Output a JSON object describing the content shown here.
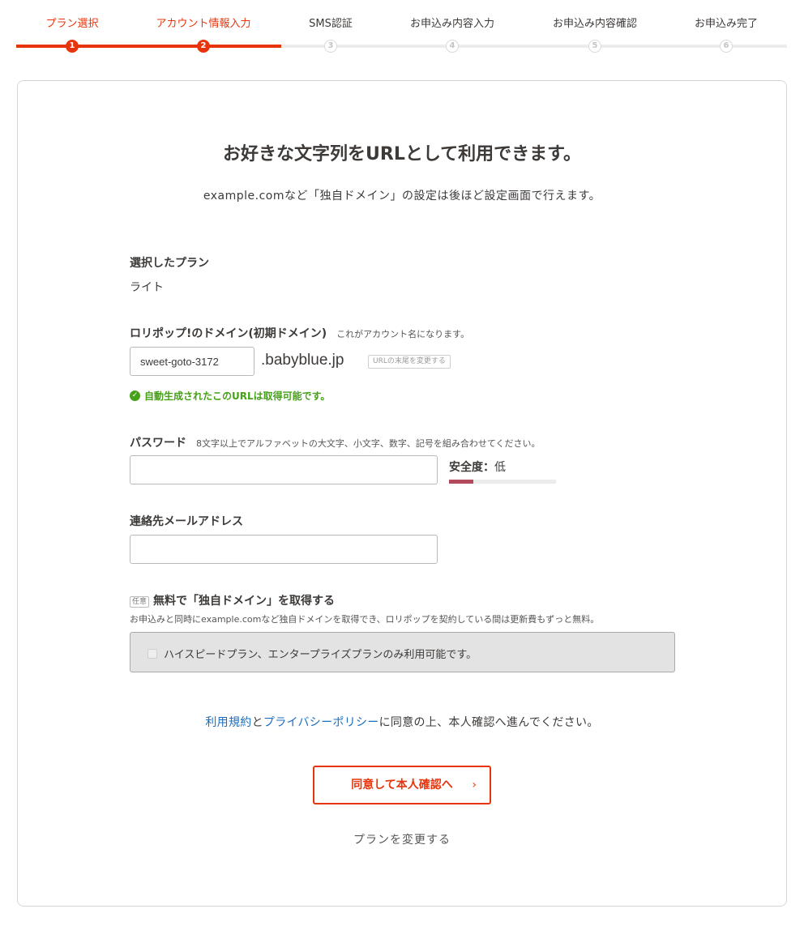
{
  "steps": [
    {
      "label": "プラン選択",
      "number": "1",
      "active": true
    },
    {
      "label": "アカウント情報入力",
      "number": "2",
      "active": true
    },
    {
      "label": "SMS認証",
      "number": "3",
      "active": false
    },
    {
      "label": "お申込み内容入力",
      "number": "4",
      "active": false
    },
    {
      "label": "お申込み内容確認",
      "number": "5",
      "active": false
    },
    {
      "label": "お申込み完了",
      "number": "6",
      "active": false
    }
  ],
  "main": {
    "headline": "お好きな文字列をURLとして利用できます。",
    "subline": "example.comなど「独自ドメイン」の設定は後ほど設定画面で行えます。"
  },
  "plan": {
    "label": "選択したプラン",
    "value": "ライト"
  },
  "domain": {
    "label": "ロリポップ!のドメイン(初期ドメイン)",
    "hint": "これがアカウント名になります。",
    "value": "sweet-goto-3172",
    "suffix": ".babyblue.jp",
    "change_label": "URLの末尾を変更する",
    "ok_message": "自動生成されたこのURLは取得可能です。"
  },
  "password": {
    "label": "パスワード",
    "hint": "8文字以上でアルファベットの大文字、小文字、数字、記号を組み合わせてください。",
    "value": "",
    "strength_label": "安全度：",
    "strength_level": "低",
    "strength_fraction": 0.23
  },
  "email": {
    "label": "連絡先メールアドレス",
    "value": ""
  },
  "custom_domain": {
    "badge": "任意",
    "label": "無料で「独自ドメイン」を取得する",
    "description": "お申込みと同時にexample.comなど独自ドメインを取得でき、ロリポップを契約している間は更新費もずっと無料。",
    "disabled_text": "ハイスピードプラン、エンタープライズプランのみ利用可能です。"
  },
  "agreement": {
    "terms_link": "利用規約",
    "and": "と",
    "privacy_link": "プライバシーポリシー",
    "rest": "に同意の上、本人確認へ進んでください。"
  },
  "cta": {
    "label": "同意して本人確認へ",
    "arrow": "›"
  },
  "change_plan": "プランを変更する",
  "colors": {
    "accent": "#e8340c",
    "success": "#45a117",
    "link": "#1a6dc1",
    "strength_low": "#b34a5b"
  }
}
